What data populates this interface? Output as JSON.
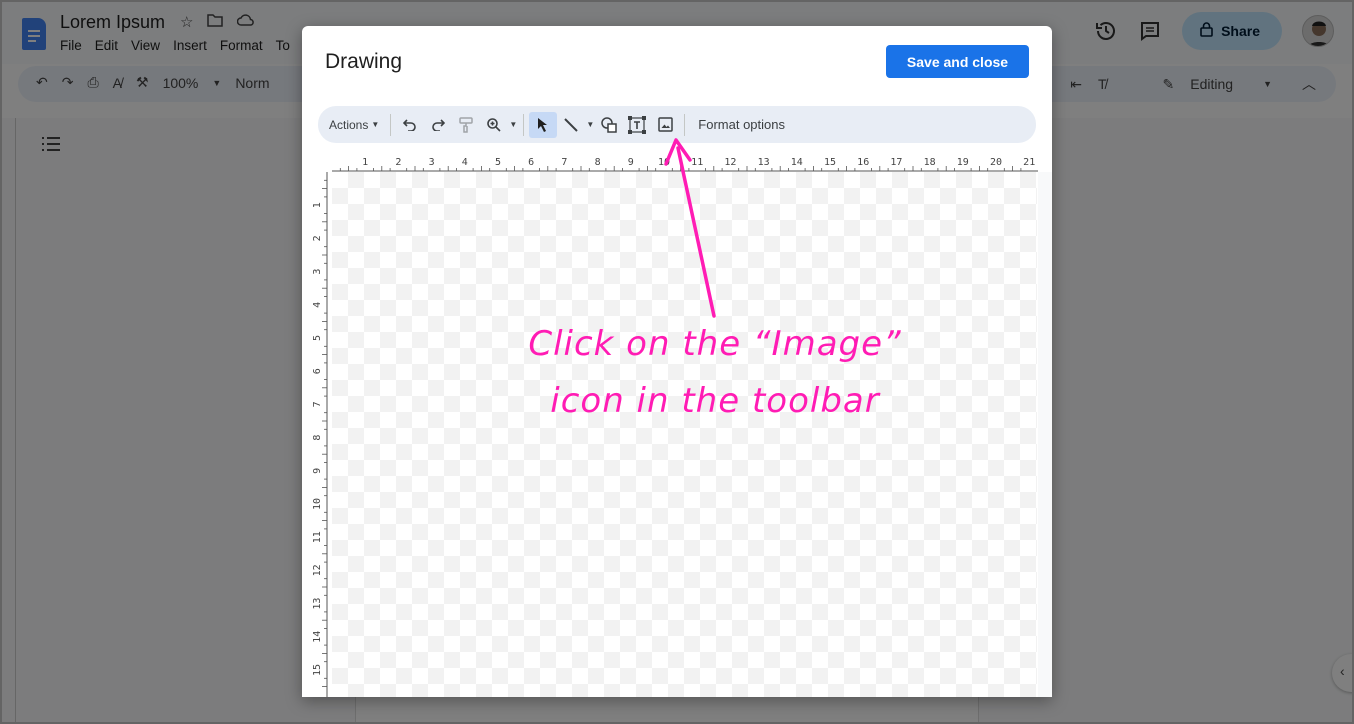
{
  "doc": {
    "title": "Lorem Ipsum",
    "menu": [
      "File",
      "Edit",
      "View",
      "Insert",
      "Format",
      "To"
    ],
    "zoom": "100%",
    "style_label": "Norm",
    "mode_label": "Editing",
    "share_label": "Share"
  },
  "dialog": {
    "title": "Drawing",
    "save_label": "Save and close",
    "toolbar": {
      "actions_label": "Actions",
      "format_options_label": "Format options"
    },
    "ruler_h": [
      "1",
      "2",
      "3",
      "4",
      "5",
      "6",
      "7",
      "8",
      "9",
      "10",
      "11",
      "12",
      "13",
      "14",
      "15",
      "16",
      "17",
      "18",
      "19",
      "20",
      "21"
    ],
    "ruler_v": [
      "1",
      "2",
      "3",
      "4",
      "5",
      "6",
      "7",
      "8",
      "9",
      "10",
      "11",
      "12",
      "13",
      "14",
      "15"
    ]
  },
  "annotation": {
    "line1": "Click on the “Image”",
    "line2": "icon in the toolbar",
    "color": "#ff1cb4"
  },
  "colors": {
    "accent": "#1a73e8",
    "share_bg": "#c2e7ff"
  }
}
